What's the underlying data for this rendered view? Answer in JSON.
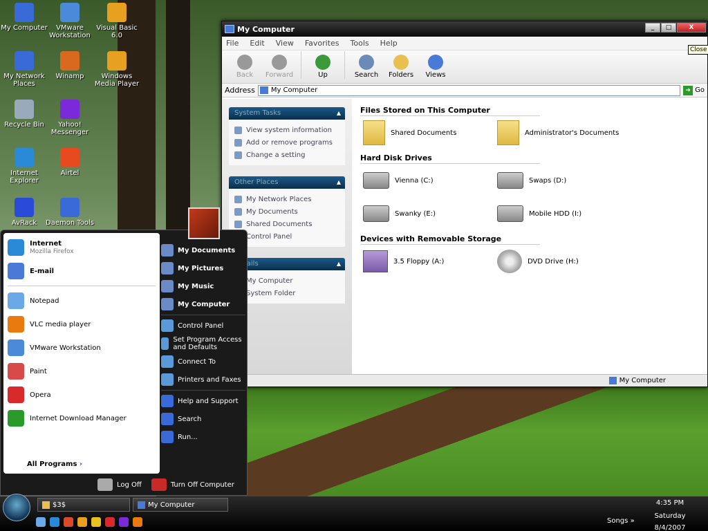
{
  "desktop": {
    "icons": [
      {
        "label": "My Computer",
        "icon": "my-computer-icon",
        "color": "#3a6ad8"
      },
      {
        "label": "VMware Workstation",
        "icon": "vmware-icon",
        "color": "#4a8ad8"
      },
      {
        "label": "Visual Basic 6.0",
        "icon": "visual-basic-icon",
        "color": "#e8a020"
      },
      {
        "label": "My Network Places",
        "icon": "network-icon",
        "color": "#3a6ad8"
      },
      {
        "label": "Winamp",
        "icon": "winamp-icon",
        "color": "#d86a20"
      },
      {
        "label": "Windows Media Player",
        "icon": "media-player-icon",
        "color": "#e8a020"
      },
      {
        "label": "Recycle Bin",
        "icon": "recycle-bin-icon",
        "color": "#9ab"
      },
      {
        "label": "Yahoo! Messenger",
        "icon": "yahoo-icon",
        "color": "#7a2ad8"
      },
      {
        "label": "Internet Explorer",
        "icon": "ie-icon",
        "color": "#2a8ad8"
      },
      {
        "label": "Airtel",
        "icon": "airtel-icon",
        "color": "#e84a20"
      },
      {
        "label": "AvRack",
        "icon": "avrack-icon",
        "color": "#2a4ad8"
      },
      {
        "label": "Daemon Tools",
        "icon": "daemon-tools-icon",
        "color": "#3a6ad8"
      }
    ]
  },
  "window": {
    "title": "My Computer",
    "buttons": {
      "min": "_",
      "max": "□",
      "close": "X"
    },
    "tooltip": "Close",
    "menu": [
      "File",
      "Edit",
      "View",
      "Favorites",
      "Tools",
      "Help"
    ],
    "toolbar": [
      {
        "label": "Back",
        "icon": "back-icon",
        "disabled": true
      },
      {
        "label": "Forward",
        "icon": "forward-icon",
        "disabled": true
      },
      {
        "label": "Up",
        "icon": "up-icon",
        "disabled": false
      },
      {
        "label": "Search",
        "icon": "search-icon",
        "disabled": false
      },
      {
        "label": "Folders",
        "icon": "folders-icon",
        "disabled": false
      },
      {
        "label": "Views",
        "icon": "views-icon",
        "disabled": false
      }
    ],
    "address_label": "Address",
    "address_value": "My Computer",
    "go_label": "Go",
    "panels": [
      {
        "title": "System Tasks",
        "items": [
          "View system information",
          "Add or remove programs",
          "Change a setting"
        ]
      },
      {
        "title": "Other Places",
        "items": [
          "My Network Places",
          "My Documents",
          "Shared Documents",
          "Control Panel"
        ]
      },
      {
        "title": "Details",
        "items": [
          "My Computer",
          "System Folder"
        ]
      }
    ],
    "sections": [
      {
        "title": "Files Stored on This Computer",
        "kind": "folder",
        "items": [
          "Shared Documents",
          "Administrator's Documents"
        ]
      },
      {
        "title": "Hard Disk Drives",
        "kind": "drive",
        "items": [
          "Vienna (C:)",
          "Swaps (D:)",
          "Swanky (E:)",
          "Mobile HDD (I:)"
        ]
      },
      {
        "title": "Devices with Removable Storage",
        "kind": "removable",
        "items": [
          "3.5 Floppy (A:)",
          "DVD Drive (H:)"
        ]
      }
    ],
    "status_text": "My Computer"
  },
  "start_menu": {
    "pinned": [
      {
        "title": "Internet",
        "sub": "Mozilla Firefox",
        "icon": "internet-icon",
        "color": "#2a8ad8"
      },
      {
        "title": "E-mail",
        "sub": "",
        "icon": "email-icon",
        "color": "#4a7ad8"
      }
    ],
    "recent": [
      {
        "label": "Notepad",
        "icon": "notepad-icon",
        "color": "#6aa8e8"
      },
      {
        "label": "VLC media player",
        "icon": "vlc-icon",
        "color": "#e87a10"
      },
      {
        "label": "VMware Workstation",
        "icon": "vmware-icon",
        "color": "#4a8ad8"
      },
      {
        "label": "Paint",
        "icon": "paint-icon",
        "color": "#d84a4a"
      },
      {
        "label": "Opera",
        "icon": "opera-icon",
        "color": "#d82a2a"
      },
      {
        "label": "Internet Download Manager",
        "icon": "idm-icon",
        "color": "#2a9a2a"
      }
    ],
    "all_programs": "All Programs",
    "right_bold": [
      "My Documents",
      "My Pictures",
      "My Music",
      "My Computer"
    ],
    "right": [
      {
        "label": "Control Panel",
        "icon": "control-panel-icon"
      },
      {
        "label": "Set Program Access and Defaults",
        "icon": "program-access-icon"
      },
      {
        "label": "Connect To",
        "icon": "connect-icon"
      },
      {
        "label": "Printers and Faxes",
        "icon": "printer-icon"
      }
    ],
    "right2": [
      {
        "label": "Help and Support",
        "icon": "help-icon"
      },
      {
        "label": "Search",
        "icon": "search-icon"
      },
      {
        "label": "Run...",
        "icon": "run-icon"
      }
    ],
    "log_off": "Log Off",
    "turn_off": "Turn Off Computer"
  },
  "taskbar": {
    "buttons": [
      "$3$",
      "My Computer"
    ],
    "songs": "Songs",
    "time": "4:35 PM",
    "day": "Saturday",
    "date": "8/4/2007"
  }
}
